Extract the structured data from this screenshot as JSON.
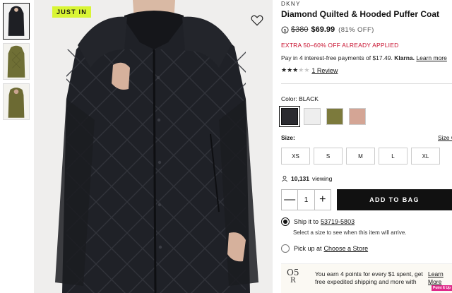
{
  "badge": "JUST IN",
  "product": {
    "brand": "DKNY",
    "title": "Diamond Quilted & Hooded Puffer Coat",
    "price_original": "$380",
    "price_sale": "$69.99",
    "price_off": "(81% OFF)",
    "promo": "EXTRA 50–60% OFF ALREADY APPLIED",
    "pay_text": "Pay in 4 interest-free payments of $17.49.",
    "pay_brand": "Klarna.",
    "pay_link": "Learn more",
    "rating_value": 3,
    "rating_max": 5,
    "review_link": "1 Review"
  },
  "color": {
    "label": "Color:",
    "selected": "BLACK",
    "swatches": [
      "#2b2b30",
      "#eeeeee",
      "#7c7a3c",
      "#d4a595"
    ]
  },
  "size": {
    "label": "Size:",
    "guide_link": "Size C",
    "options": [
      "XS",
      "S",
      "M",
      "L",
      "XL"
    ]
  },
  "viewing": {
    "count": "10,131",
    "suffix": "viewing"
  },
  "quantity": {
    "minus": "—",
    "value": "1",
    "plus": "+"
  },
  "add_to_bag": "ADD TO BAG",
  "shipping": {
    "prefix": "Ship it to",
    "zip": "53719-5803",
    "note": "Select a size to see when this item will arrive."
  },
  "pickup": {
    "prefix": "Pick up at",
    "link": "Choose a Store"
  },
  "rewards": {
    "logo_top": "O5",
    "logo_bottom": "R",
    "text": "You earn 4 points for every $1 spent, get free expedited shipping and more with",
    "link": "Learn More"
  },
  "pin_label": "Point It Up",
  "icons": {
    "wishlist": "heart-icon",
    "info": "info-circle-icon",
    "viewers": "person-icon"
  }
}
